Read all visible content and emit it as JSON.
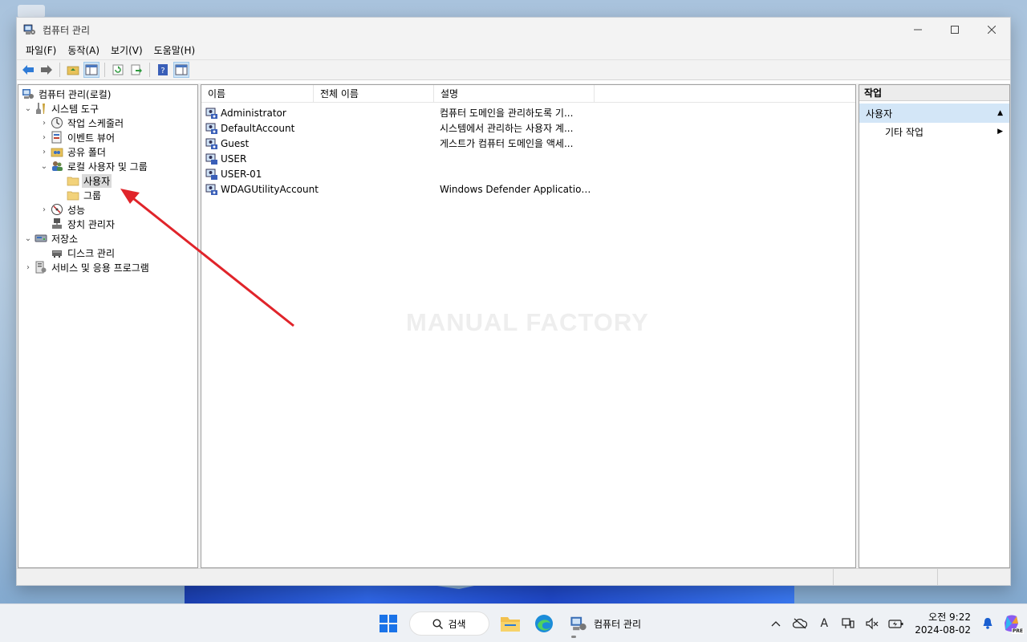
{
  "window": {
    "title": "컴퓨터 관리",
    "menu": [
      "파일(F)",
      "동작(A)",
      "보기(V)",
      "도움말(H)"
    ]
  },
  "tree": {
    "root": "컴퓨터 관리(로컬)",
    "system_tools": "시스템 도구",
    "task_scheduler": "작업 스케줄러",
    "event_viewer": "이벤트 뷰어",
    "shared_folders": "공유 폴더",
    "local_users_groups": "로컬 사용자 및 그룹",
    "users": "사용자",
    "groups": "그룹",
    "performance": "성능",
    "device_manager": "장치 관리자",
    "storage": "저장소",
    "disk_management": "디스크 관리",
    "services_apps": "서비스 및 응용 프로그램"
  },
  "list": {
    "columns": [
      "이름",
      "전체 이름",
      "설명"
    ],
    "rows": [
      {
        "name": "Administrator",
        "full_name": "",
        "description": "컴퓨터 도메인을 관리하도록 기..."
      },
      {
        "name": "DefaultAccount",
        "full_name": "",
        "description": "시스템에서 관리하는 사용자 계..."
      },
      {
        "name": "Guest",
        "full_name": "",
        "description": "게스트가 컴퓨터 도메인을 액세..."
      },
      {
        "name": "USER",
        "full_name": "",
        "description": ""
      },
      {
        "name": "USER-01",
        "full_name": "",
        "description": ""
      },
      {
        "name": "WDAGUtilityAccount",
        "full_name": "",
        "description": "Windows Defender Application G..."
      }
    ],
    "watermark": "MANUAL FACTORY"
  },
  "actions": {
    "header": "작업",
    "section": "사용자",
    "more": "기타 작업"
  },
  "taskbar": {
    "search_label": "검색",
    "app_label": "컴퓨터 관리",
    "time": "오전 9:22",
    "date": "2024-08-02",
    "ime": "A",
    "badge": "PRE"
  },
  "colors": {
    "selection": "#d9d9d9",
    "action_section": "#d3e6f7",
    "annotation_arrow": "#e0242a"
  }
}
